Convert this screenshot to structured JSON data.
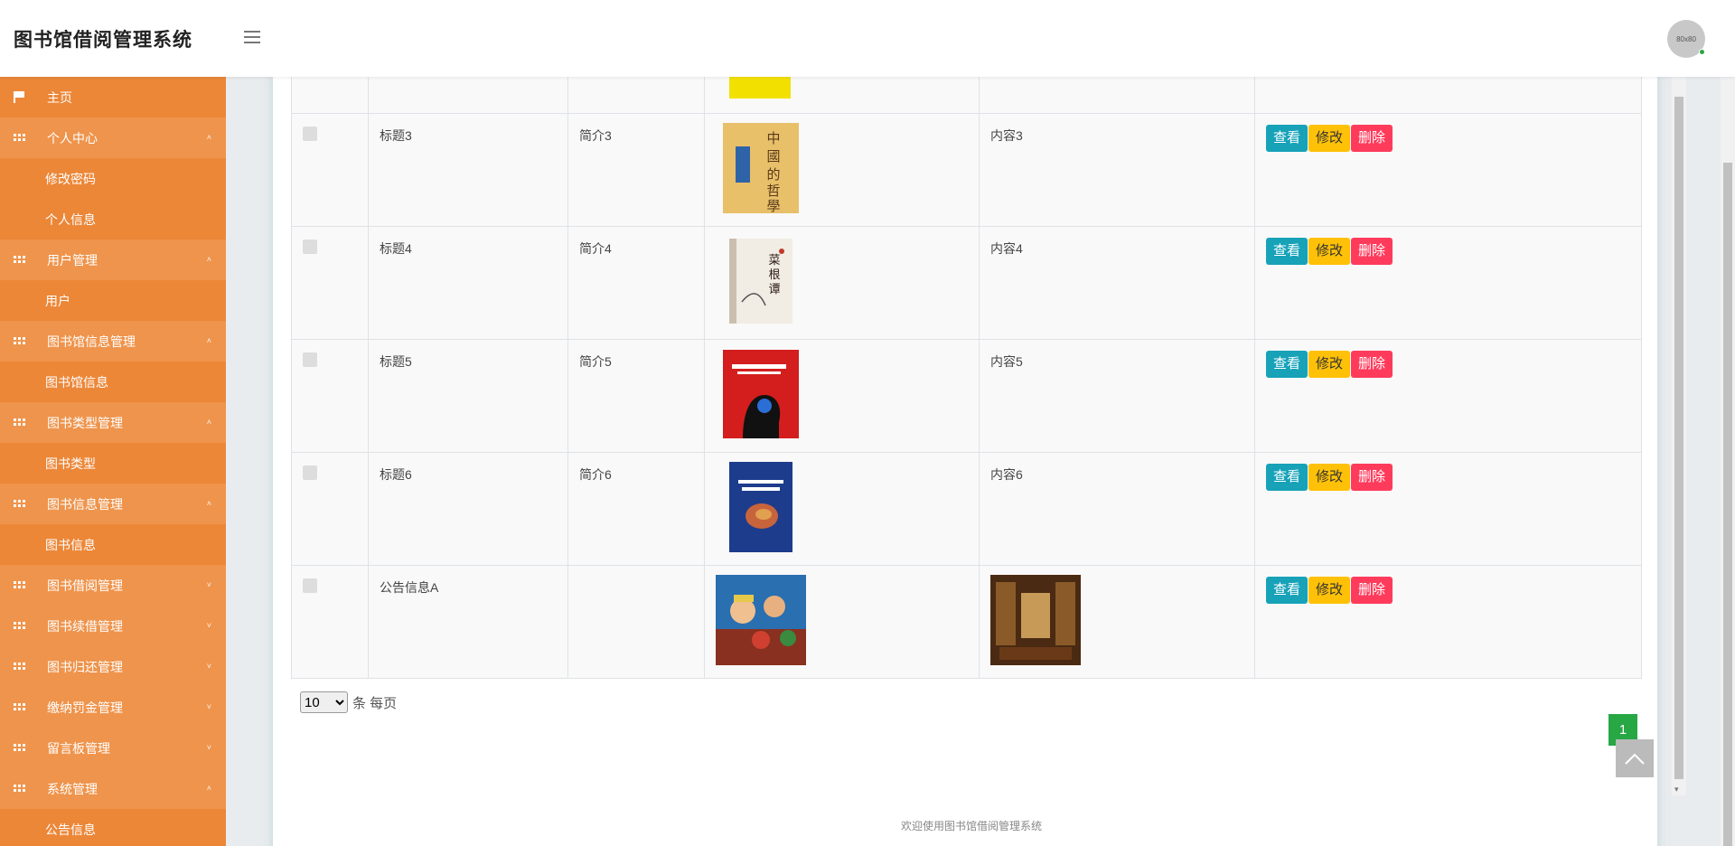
{
  "app": {
    "title": "图书馆借阅管理系统",
    "avatar_text": "80x80"
  },
  "sidebar": {
    "items": [
      {
        "label": "主页",
        "type": "top",
        "icon": "flag-icon"
      },
      {
        "label": "个人中心",
        "type": "parent",
        "icon": "grid-icon",
        "caret": "˄"
      },
      {
        "label": "修改密码",
        "type": "child"
      },
      {
        "label": "个人信息",
        "type": "child"
      },
      {
        "label": "用户管理",
        "type": "parent",
        "icon": "grid-icon",
        "caret": "˄"
      },
      {
        "label": "用户",
        "type": "child"
      },
      {
        "label": "图书馆信息管理",
        "type": "parent",
        "icon": "grid-icon",
        "caret": "˄"
      },
      {
        "label": "图书馆信息",
        "type": "child"
      },
      {
        "label": "图书类型管理",
        "type": "parent",
        "icon": "grid-icon",
        "caret": "˄"
      },
      {
        "label": "图书类型",
        "type": "child"
      },
      {
        "label": "图书信息管理",
        "type": "parent",
        "icon": "grid-icon",
        "caret": "˄"
      },
      {
        "label": "图书信息",
        "type": "child"
      },
      {
        "label": "图书借阅管理",
        "type": "parent",
        "icon": "grid-icon",
        "caret": "˅"
      },
      {
        "label": "图书续借管理",
        "type": "parent",
        "icon": "grid-icon",
        "caret": "˅"
      },
      {
        "label": "图书归还管理",
        "type": "parent",
        "icon": "grid-icon",
        "caret": "˅"
      },
      {
        "label": "缴纳罚金管理",
        "type": "parent",
        "icon": "grid-icon",
        "caret": "˅"
      },
      {
        "label": "留言板管理",
        "type": "parent",
        "icon": "grid-icon",
        "caret": "˅"
      },
      {
        "label": "系统管理",
        "type": "parent",
        "icon": "grid-icon",
        "caret": "˄"
      },
      {
        "label": "公告信息",
        "type": "child"
      }
    ]
  },
  "table": {
    "rows": [
      {
        "title": "标题3",
        "intro": "简介3",
        "content": "内容3",
        "image": "book-cover-chinese-philosophy"
      },
      {
        "title": "标题4",
        "intro": "简介4",
        "content": "内容4",
        "image": "book-cover-caigentan"
      },
      {
        "title": "标题5",
        "intro": "简介5",
        "content": "内容5",
        "image": "book-cover-memory"
      },
      {
        "title": "标题6",
        "intro": "简介6",
        "content": "内容6",
        "image": "book-cover-surgery"
      },
      {
        "title": "公告信息A",
        "intro": "",
        "content": "",
        "image": "anime-poster",
        "content_image": "library-photo"
      }
    ],
    "actions": {
      "view": "查看",
      "edit": "修改",
      "delete": "删除"
    }
  },
  "pagination": {
    "page_size": "10",
    "page_size_options": [
      "10"
    ],
    "per_page_label": "条 每页",
    "current_page": "1"
  },
  "footer": {
    "text": "欢迎使用图书馆借阅管理系统"
  },
  "colors": {
    "sidebar": "#ec8738",
    "view": "#17a2b8",
    "edit": "#ffc107",
    "delete": "#ff3b5c",
    "page": "#28a745"
  }
}
